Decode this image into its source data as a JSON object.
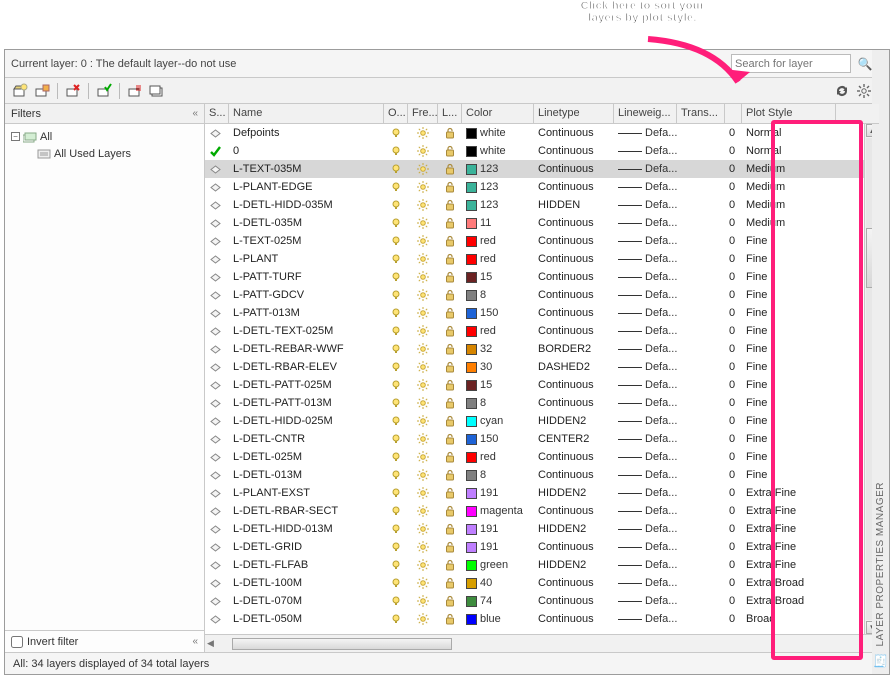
{
  "annotation": {
    "line1": "Click here to sort your",
    "line2": "layers by plot style."
  },
  "header": {
    "current_layer": "Current layer: 0 : The default layer--do not use",
    "search_placeholder": "Search for layer"
  },
  "filters": {
    "title": "Filters",
    "nodes": [
      {
        "label": "All",
        "expanded": true
      },
      {
        "label": "All Used Layers",
        "child": true
      }
    ],
    "invert_label": "Invert filter"
  },
  "columns": {
    "status": "S...",
    "name": "Name",
    "on": "O...",
    "freeze": "Fre...",
    "lock": "L...",
    "color": "Color",
    "linetype": "Linetype",
    "lineweight": "Lineweig...",
    "trans": "Trans...",
    "plotstyle": "Plot Style"
  },
  "rows": [
    {
      "name": "Defpoints",
      "color": "white",
      "swatch": "#000",
      "linetype": "Continuous",
      "lw": "Defa...",
      "tr": "0",
      "ps": "Normal",
      "s": "d"
    },
    {
      "name": "0",
      "color": "white",
      "swatch": "#000",
      "linetype": "Continuous",
      "lw": "Defa...",
      "tr": "0",
      "ps": "Normal",
      "s": "c"
    },
    {
      "name": "L-TEXT-035M",
      "color": "123",
      "swatch": "#3bb39a",
      "linetype": "Continuous",
      "lw": "Defa...",
      "tr": "0",
      "ps": "Medium",
      "s": "d",
      "sel": true
    },
    {
      "name": "L-PLANT-EDGE",
      "color": "123",
      "swatch": "#3bb39a",
      "linetype": "Continuous",
      "lw": "Defa...",
      "tr": "0",
      "ps": "Medium",
      "s": "d"
    },
    {
      "name": "L-DETL-HIDD-035M",
      "color": "123",
      "swatch": "#3bb39a",
      "linetype": "HIDDEN",
      "lw": "Defa...",
      "tr": "0",
      "ps": "Medium",
      "s": "d"
    },
    {
      "name": "L-DETL-035M",
      "color": "11",
      "swatch": "#ff7b7b",
      "linetype": "Continuous",
      "lw": "Defa...",
      "tr": "0",
      "ps": "Medium",
      "s": "d"
    },
    {
      "name": "L-TEXT-025M",
      "color": "red",
      "swatch": "#ff0000",
      "linetype": "Continuous",
      "lw": "Defa...",
      "tr": "0",
      "ps": "Fine",
      "s": "d"
    },
    {
      "name": "L-PLANT",
      "color": "red",
      "swatch": "#ff0000",
      "linetype": "Continuous",
      "lw": "Defa...",
      "tr": "0",
      "ps": "Fine",
      "s": "d"
    },
    {
      "name": "L-PATT-TURF",
      "color": "15",
      "swatch": "#6b2222",
      "linetype": "Continuous",
      "lw": "Defa...",
      "tr": "0",
      "ps": "Fine",
      "s": "d"
    },
    {
      "name": "L-PATT-GDCV",
      "color": "8",
      "swatch": "#808080",
      "linetype": "Continuous",
      "lw": "Defa...",
      "tr": "0",
      "ps": "Fine",
      "s": "d"
    },
    {
      "name": "L-PATT-013M",
      "color": "150",
      "swatch": "#1e63d6",
      "linetype": "Continuous",
      "lw": "Defa...",
      "tr": "0",
      "ps": "Fine",
      "s": "d"
    },
    {
      "name": "L-DETL-TEXT-025M",
      "color": "red",
      "swatch": "#ff0000",
      "linetype": "Continuous",
      "lw": "Defa...",
      "tr": "0",
      "ps": "Fine",
      "s": "d"
    },
    {
      "name": "L-DETL-REBAR-WWF",
      "color": "32",
      "swatch": "#d68500",
      "linetype": "BORDER2",
      "lw": "Defa...",
      "tr": "0",
      "ps": "Fine",
      "s": "d"
    },
    {
      "name": "L-DETL-RBAR-ELEV",
      "color": "30",
      "swatch": "#ff7f00",
      "linetype": "DASHED2",
      "lw": "Defa...",
      "tr": "0",
      "ps": "Fine",
      "s": "d"
    },
    {
      "name": "L-DETL-PATT-025M",
      "color": "15",
      "swatch": "#6b2222",
      "linetype": "Continuous",
      "lw": "Defa...",
      "tr": "0",
      "ps": "Fine",
      "s": "d"
    },
    {
      "name": "L-DETL-PATT-013M",
      "color": "8",
      "swatch": "#808080",
      "linetype": "Continuous",
      "lw": "Defa...",
      "tr": "0",
      "ps": "Fine",
      "s": "d"
    },
    {
      "name": "L-DETL-HIDD-025M",
      "color": "cyan",
      "swatch": "#00ffff",
      "linetype": "HIDDEN2",
      "lw": "Defa...",
      "tr": "0",
      "ps": "Fine",
      "s": "d"
    },
    {
      "name": "L-DETL-CNTR",
      "color": "150",
      "swatch": "#1e63d6",
      "linetype": "CENTER2",
      "lw": "Defa...",
      "tr": "0",
      "ps": "Fine",
      "s": "d"
    },
    {
      "name": "L-DETL-025M",
      "color": "red",
      "swatch": "#ff0000",
      "linetype": "Continuous",
      "lw": "Defa...",
      "tr": "0",
      "ps": "Fine",
      "s": "d"
    },
    {
      "name": "L-DETL-013M",
      "color": "8",
      "swatch": "#808080",
      "linetype": "Continuous",
      "lw": "Defa...",
      "tr": "0",
      "ps": "Fine",
      "s": "d"
    },
    {
      "name": "L-PLANT-EXST",
      "color": "191",
      "swatch": "#bf7fff",
      "linetype": "HIDDEN2",
      "lw": "Defa...",
      "tr": "0",
      "ps": "Extra Fine",
      "s": "d"
    },
    {
      "name": "L-DETL-RBAR-SECT",
      "color": "magenta",
      "swatch": "#ff00ff",
      "linetype": "Continuous",
      "lw": "Defa...",
      "tr": "0",
      "ps": "Extra Fine",
      "s": "d"
    },
    {
      "name": "L-DETL-HIDD-013M",
      "color": "191",
      "swatch": "#bf7fff",
      "linetype": "HIDDEN2",
      "lw": "Defa...",
      "tr": "0",
      "ps": "Extra Fine",
      "s": "d"
    },
    {
      "name": "L-DETL-GRID",
      "color": "191",
      "swatch": "#bf7fff",
      "linetype": "Continuous",
      "lw": "Defa...",
      "tr": "0",
      "ps": "Extra Fine",
      "s": "d"
    },
    {
      "name": "L-DETL-FLFAB",
      "color": "green",
      "swatch": "#00ff00",
      "linetype": "HIDDEN2",
      "lw": "Defa...",
      "tr": "0",
      "ps": "Extra Fine",
      "s": "d"
    },
    {
      "name": "L-DETL-100M",
      "color": "40",
      "swatch": "#d69e00",
      "linetype": "Continuous",
      "lw": "Defa...",
      "tr": "0",
      "ps": "Extra Broad",
      "s": "d"
    },
    {
      "name": "L-DETL-070M",
      "color": "74",
      "swatch": "#3e8c3e",
      "linetype": "Continuous",
      "lw": "Defa...",
      "tr": "0",
      "ps": "Extra Broad",
      "s": "d"
    },
    {
      "name": "L-DETL-050M",
      "color": "blue",
      "swatch": "#0000ff",
      "linetype": "Continuous",
      "lw": "Defa...",
      "tr": "0",
      "ps": "Broad",
      "s": "d"
    }
  ],
  "status": "All: 34 layers displayed of 34 total layers",
  "side_tab": "LAYER PROPERTIES MANAGER"
}
